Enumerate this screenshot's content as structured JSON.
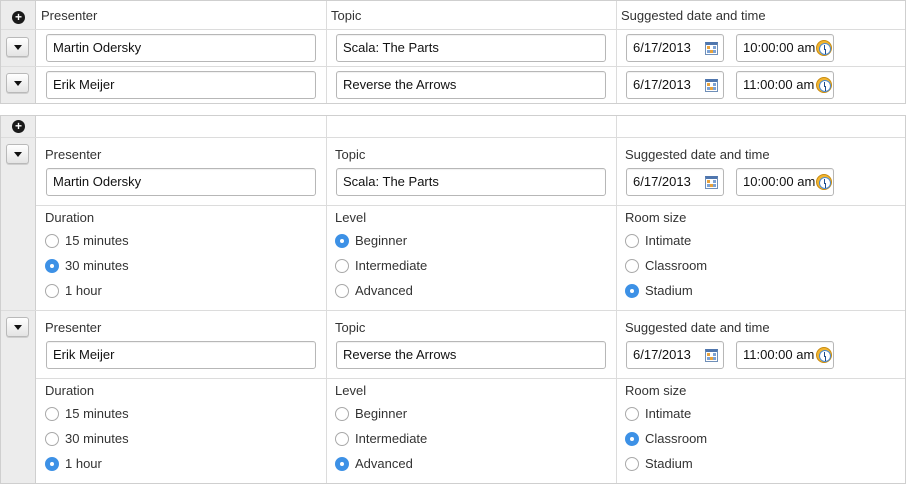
{
  "columns": {
    "presenter": "Presenter",
    "topic": "Topic",
    "when": "Suggested date and time"
  },
  "detail_labels": {
    "duration": "Duration",
    "level": "Level",
    "room_size": "Room size"
  },
  "table1": {
    "rows": [
      {
        "presenter": "Martin Odersky",
        "topic": "Scala: The Parts",
        "date": "6/17/2013",
        "time": "10:00:00 am"
      },
      {
        "presenter": "Erik Meijer",
        "topic": "Reverse the Arrows",
        "date": "6/17/2013",
        "time": "11:00:00 am"
      }
    ]
  },
  "table2": {
    "rows": [
      {
        "presenter": "Martin Odersky",
        "topic": "Scala: The Parts",
        "date": "6/17/2013",
        "time": "10:00:00 am",
        "duration": [
          {
            "label": "15 minutes",
            "selected": false
          },
          {
            "label": "30 minutes",
            "selected": true
          },
          {
            "label": "1 hour",
            "selected": false
          }
        ],
        "level": [
          {
            "label": "Beginner",
            "selected": true
          },
          {
            "label": "Intermediate",
            "selected": false
          },
          {
            "label": "Advanced",
            "selected": false
          }
        ],
        "room": [
          {
            "label": "Intimate",
            "selected": false
          },
          {
            "label": "Classroom",
            "selected": false
          },
          {
            "label": "Stadium",
            "selected": true
          }
        ]
      },
      {
        "presenter": "Erik Meijer",
        "topic": "Reverse the Arrows",
        "date": "6/17/2013",
        "time": "11:00:00 am",
        "duration": [
          {
            "label": "15 minutes",
            "selected": false
          },
          {
            "label": "30 minutes",
            "selected": false
          },
          {
            "label": "1 hour",
            "selected": true
          }
        ],
        "level": [
          {
            "label": "Beginner",
            "selected": false
          },
          {
            "label": "Intermediate",
            "selected": false
          },
          {
            "label": "Advanced",
            "selected": true
          }
        ],
        "room": [
          {
            "label": "Intimate",
            "selected": false
          },
          {
            "label": "Classroom",
            "selected": true
          },
          {
            "label": "Stadium",
            "selected": false
          }
        ]
      }
    ]
  },
  "icons": {
    "add": "plus-circle-icon",
    "row_menu": "chevron-down-icon",
    "date": "calendar-icon",
    "time": "clock-icon"
  },
  "colors": {
    "radio_selected": "#3d91e6",
    "gutter": "#ececec",
    "border": "#cfcfcf"
  }
}
